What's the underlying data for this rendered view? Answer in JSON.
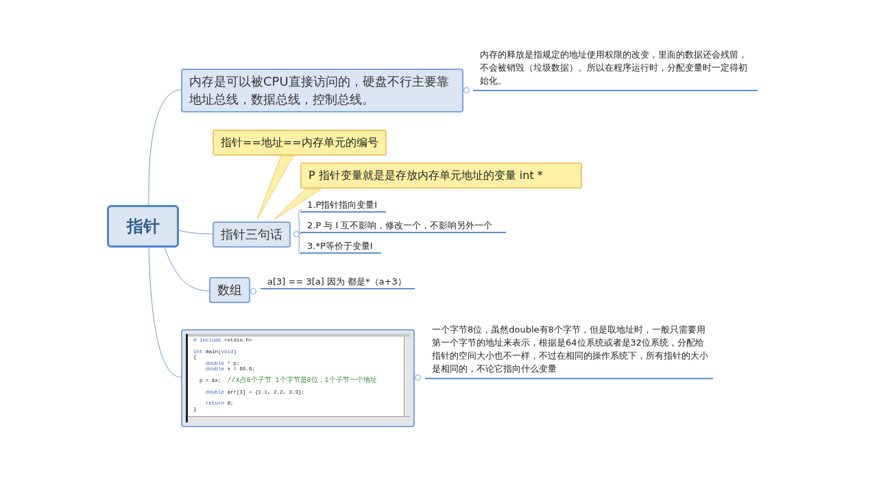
{
  "root": {
    "label": "指针"
  },
  "topics": [
    {
      "kind": "text",
      "label": "内存是可以被CPU直接访问的，硬盘不行主要靠地址总线，数据总线，控制总线。",
      "note": "内存的释放是指规定的地址使用权限的改变，里面的数据还会残留，不会被销毁（垃圾数据）。所以在程序运行时，分配变量时一定得初始化。"
    },
    {
      "kind": "text",
      "label": "指针三句话",
      "callouts": [
        "指针==地址==内存单元的编号",
        "P 指针变量就是是存放内存单元地址的变量  int *"
      ],
      "children": [
        "1.P指针指向变量I",
        "2.P 与 I 互不影响，修改一个，不影响另外一个",
        "3.*P等价于变量I"
      ]
    },
    {
      "kind": "text",
      "label": "数组",
      "children": [
        "a[3] == 3[a]  因为 都是*（a+3）"
      ]
    },
    {
      "kind": "code",
      "code_lines": [
        {
          "gap_before": false,
          "segments": [
            {
              "text": "# include ",
              "kind": "keyword"
            },
            {
              "text": "<stdio.h>",
              "kind": "plain"
            }
          ]
        },
        {
          "gap_before": true,
          "segments": [
            {
              "text": "int ",
              "kind": "keyword"
            },
            {
              "text": "main(",
              "kind": "plain"
            },
            {
              "text": "void",
              "kind": "keyword"
            },
            {
              "text": ")",
              "kind": "plain"
            }
          ]
        },
        {
          "gap_before": false,
          "segments": [
            {
              "text": "{",
              "kind": "plain"
            }
          ]
        },
        {
          "gap_before": false,
          "segments": [
            {
              "text": "    double",
              "kind": "keyword"
            },
            {
              "text": " * p;",
              "kind": "plain"
            }
          ]
        },
        {
          "gap_before": false,
          "segments": [
            {
              "text": "    double",
              "kind": "keyword"
            },
            {
              "text": " x = 66.6;",
              "kind": "plain"
            }
          ]
        },
        {
          "gap_before": true,
          "segments": [
            {
              "text": "  p = &x;  ",
              "kind": "plain"
            },
            {
              "text": "//x占8个子节 1个字节是8位，1个子节一个地址",
              "kind": "comment"
            }
          ]
        },
        {
          "gap_before": true,
          "segments": [
            {
              "text": "    double",
              "kind": "keyword"
            },
            {
              "text": " arr[3] = {1.1, 2.2, 3.3};",
              "kind": "plain"
            }
          ]
        },
        {
          "gap_before": true,
          "segments": [
            {
              "text": "    return ",
              "kind": "keyword"
            },
            {
              "text": "0;",
              "kind": "plain"
            }
          ]
        },
        {
          "gap_before": false,
          "segments": [
            {
              "text": "}",
              "kind": "plain"
            }
          ]
        }
      ],
      "note": "一个字节8位，虽然double有8个字节，但是取地址时，一般只需要用第一个字节的地址来表示，根据是64位系统或者是32位系统，分配给指针的空间大小也不一样，不过在相同的操作系统下，所有指针的大小是相同的，不论它指向什么变量"
    }
  ]
}
